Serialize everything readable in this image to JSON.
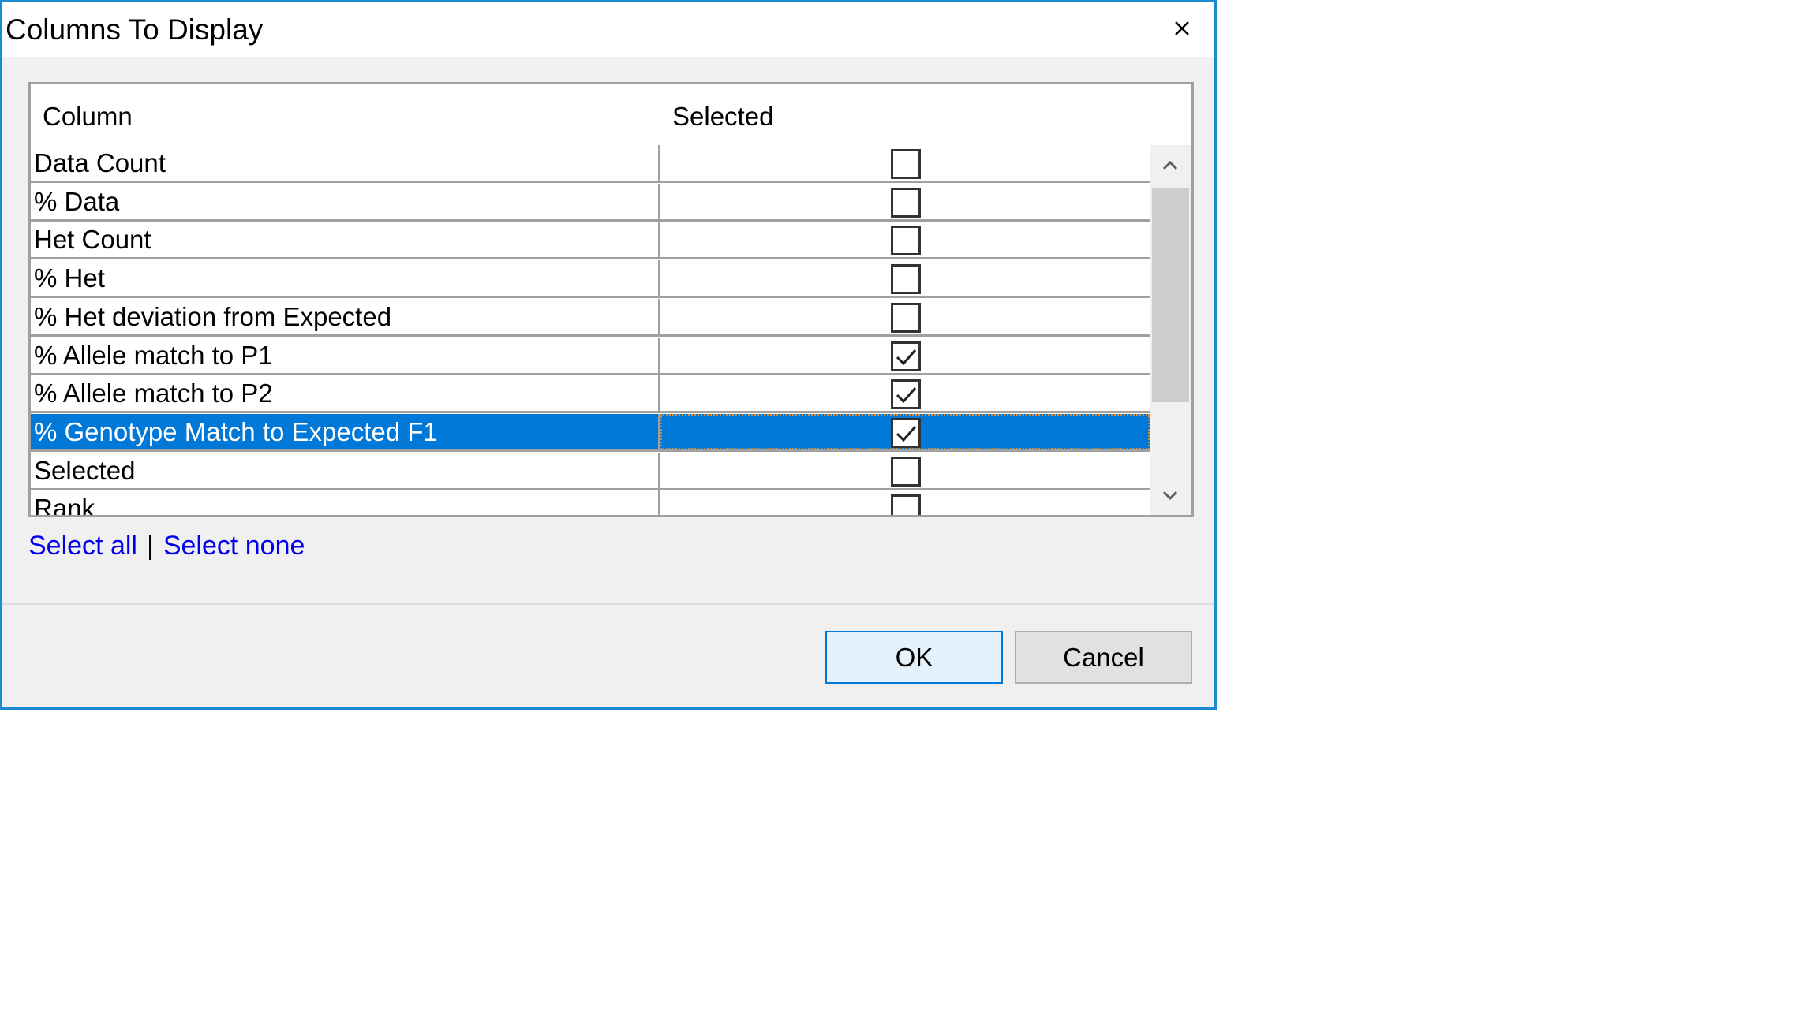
{
  "dialog": {
    "title": "Columns To Display",
    "close_icon": "close-icon"
  },
  "grid": {
    "headers": [
      "Column",
      "Selected"
    ],
    "rows": [
      {
        "name": "Data Count",
        "checked": false
      },
      {
        "name": "% Data",
        "checked": false
      },
      {
        "name": "Het Count",
        "checked": false
      },
      {
        "name": "% Het",
        "checked": false
      },
      {
        "name": "% Het deviation from Expected",
        "checked": false
      },
      {
        "name": "% Allele match to P1",
        "checked": true
      },
      {
        "name": "% Allele match to P2",
        "checked": true
      },
      {
        "name": "% Genotype Match to Expected F1",
        "checked": true,
        "selected": true
      },
      {
        "name": "Selected",
        "checked": false
      },
      {
        "name": "Rank",
        "checked": false
      }
    ],
    "scroll_up_icon": "chevron-up-icon",
    "scroll_down_icon": "chevron-down-icon"
  },
  "links": {
    "select_all": "Select all",
    "separator": "|",
    "select_none": "Select none"
  },
  "buttons": {
    "ok": "OK",
    "cancel": "Cancel"
  },
  "colors": {
    "accent": "#0078d7",
    "window_border": "#1a8ad4",
    "link": "#0000ee"
  }
}
